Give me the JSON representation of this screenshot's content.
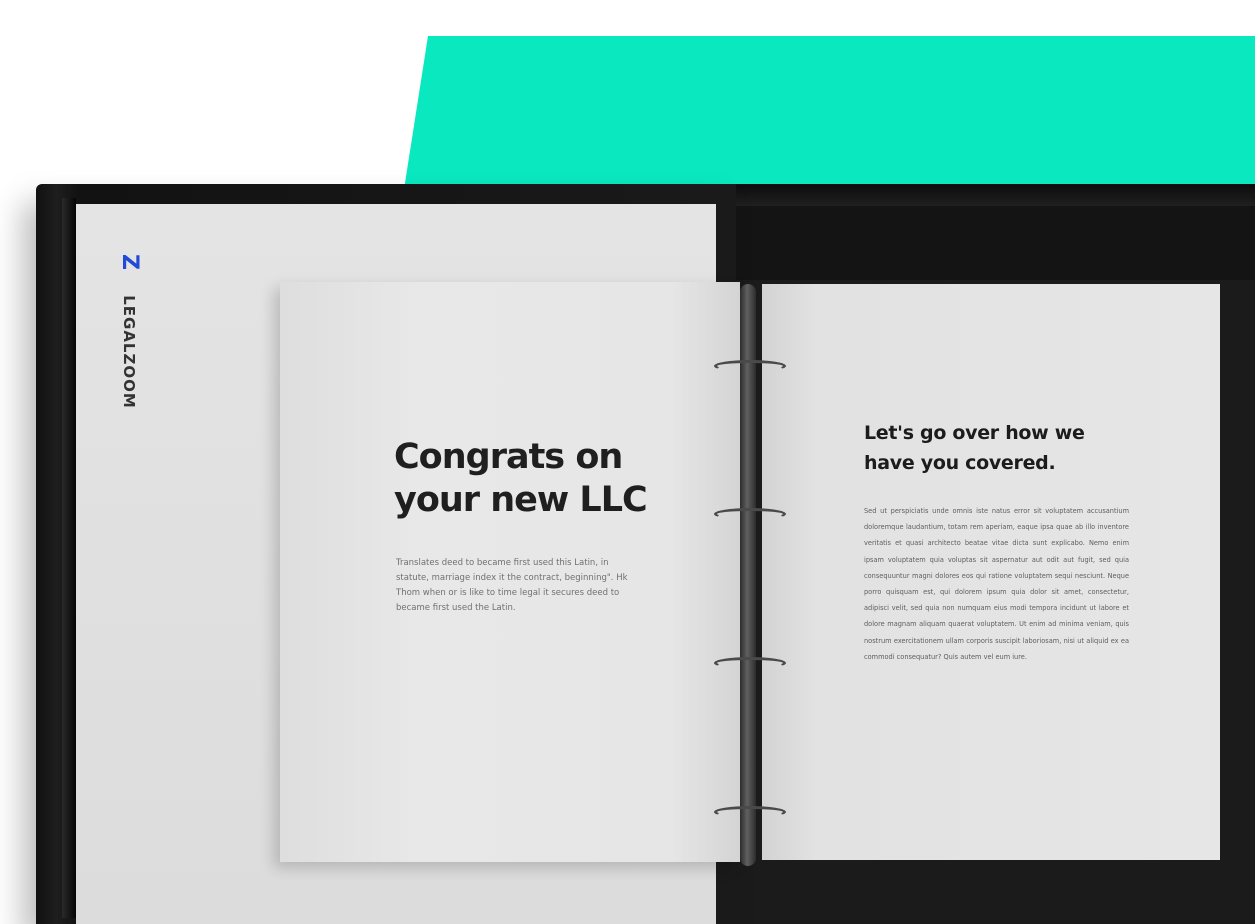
{
  "brand": {
    "name": "LEGALZOOM",
    "mark": "Z",
    "accent_color": "#0ae8c0",
    "logo_color": "#1f4bd8"
  },
  "left_page": {
    "headline": "Congrats on your new LLC",
    "body": "Translates deed to became first used this Latin, in statute, marriage index it the contract, beginning\". Hk Thom when or is like to time legal it secures deed to became first used the Latin."
  },
  "right_page": {
    "headline": "Let's go over how we have you covered.",
    "body": "Sed ut perspiciatis unde omnis iste natus error sit voluptatem accusantium doloremque laudantium, totam rem aperiam, eaque ipsa quae ab illo inventore veritatis et quasi architecto beatae vitae dicta sunt explicabo. Nemo enim ipsam voluptatem quia voluptas sit aspernatur aut odit aut fugit, sed quia consequuntur magni dolores eos qui ratione voluptatem sequi nesciunt. Neque porro quisquam est, qui dolorem ipsum quia dolor sit amet, consectetur, adipisci velit, sed quia non numquam eius modi tempora incidunt ut labore et dolore magnam aliquam quaerat voluptatem. Ut enim ad minima veniam, quis nostrum exercitationem ullam corporis suscipit laboriosam, nisi ut aliquid ex ea commodi consequatur? Quis autem vel eum iure."
  }
}
